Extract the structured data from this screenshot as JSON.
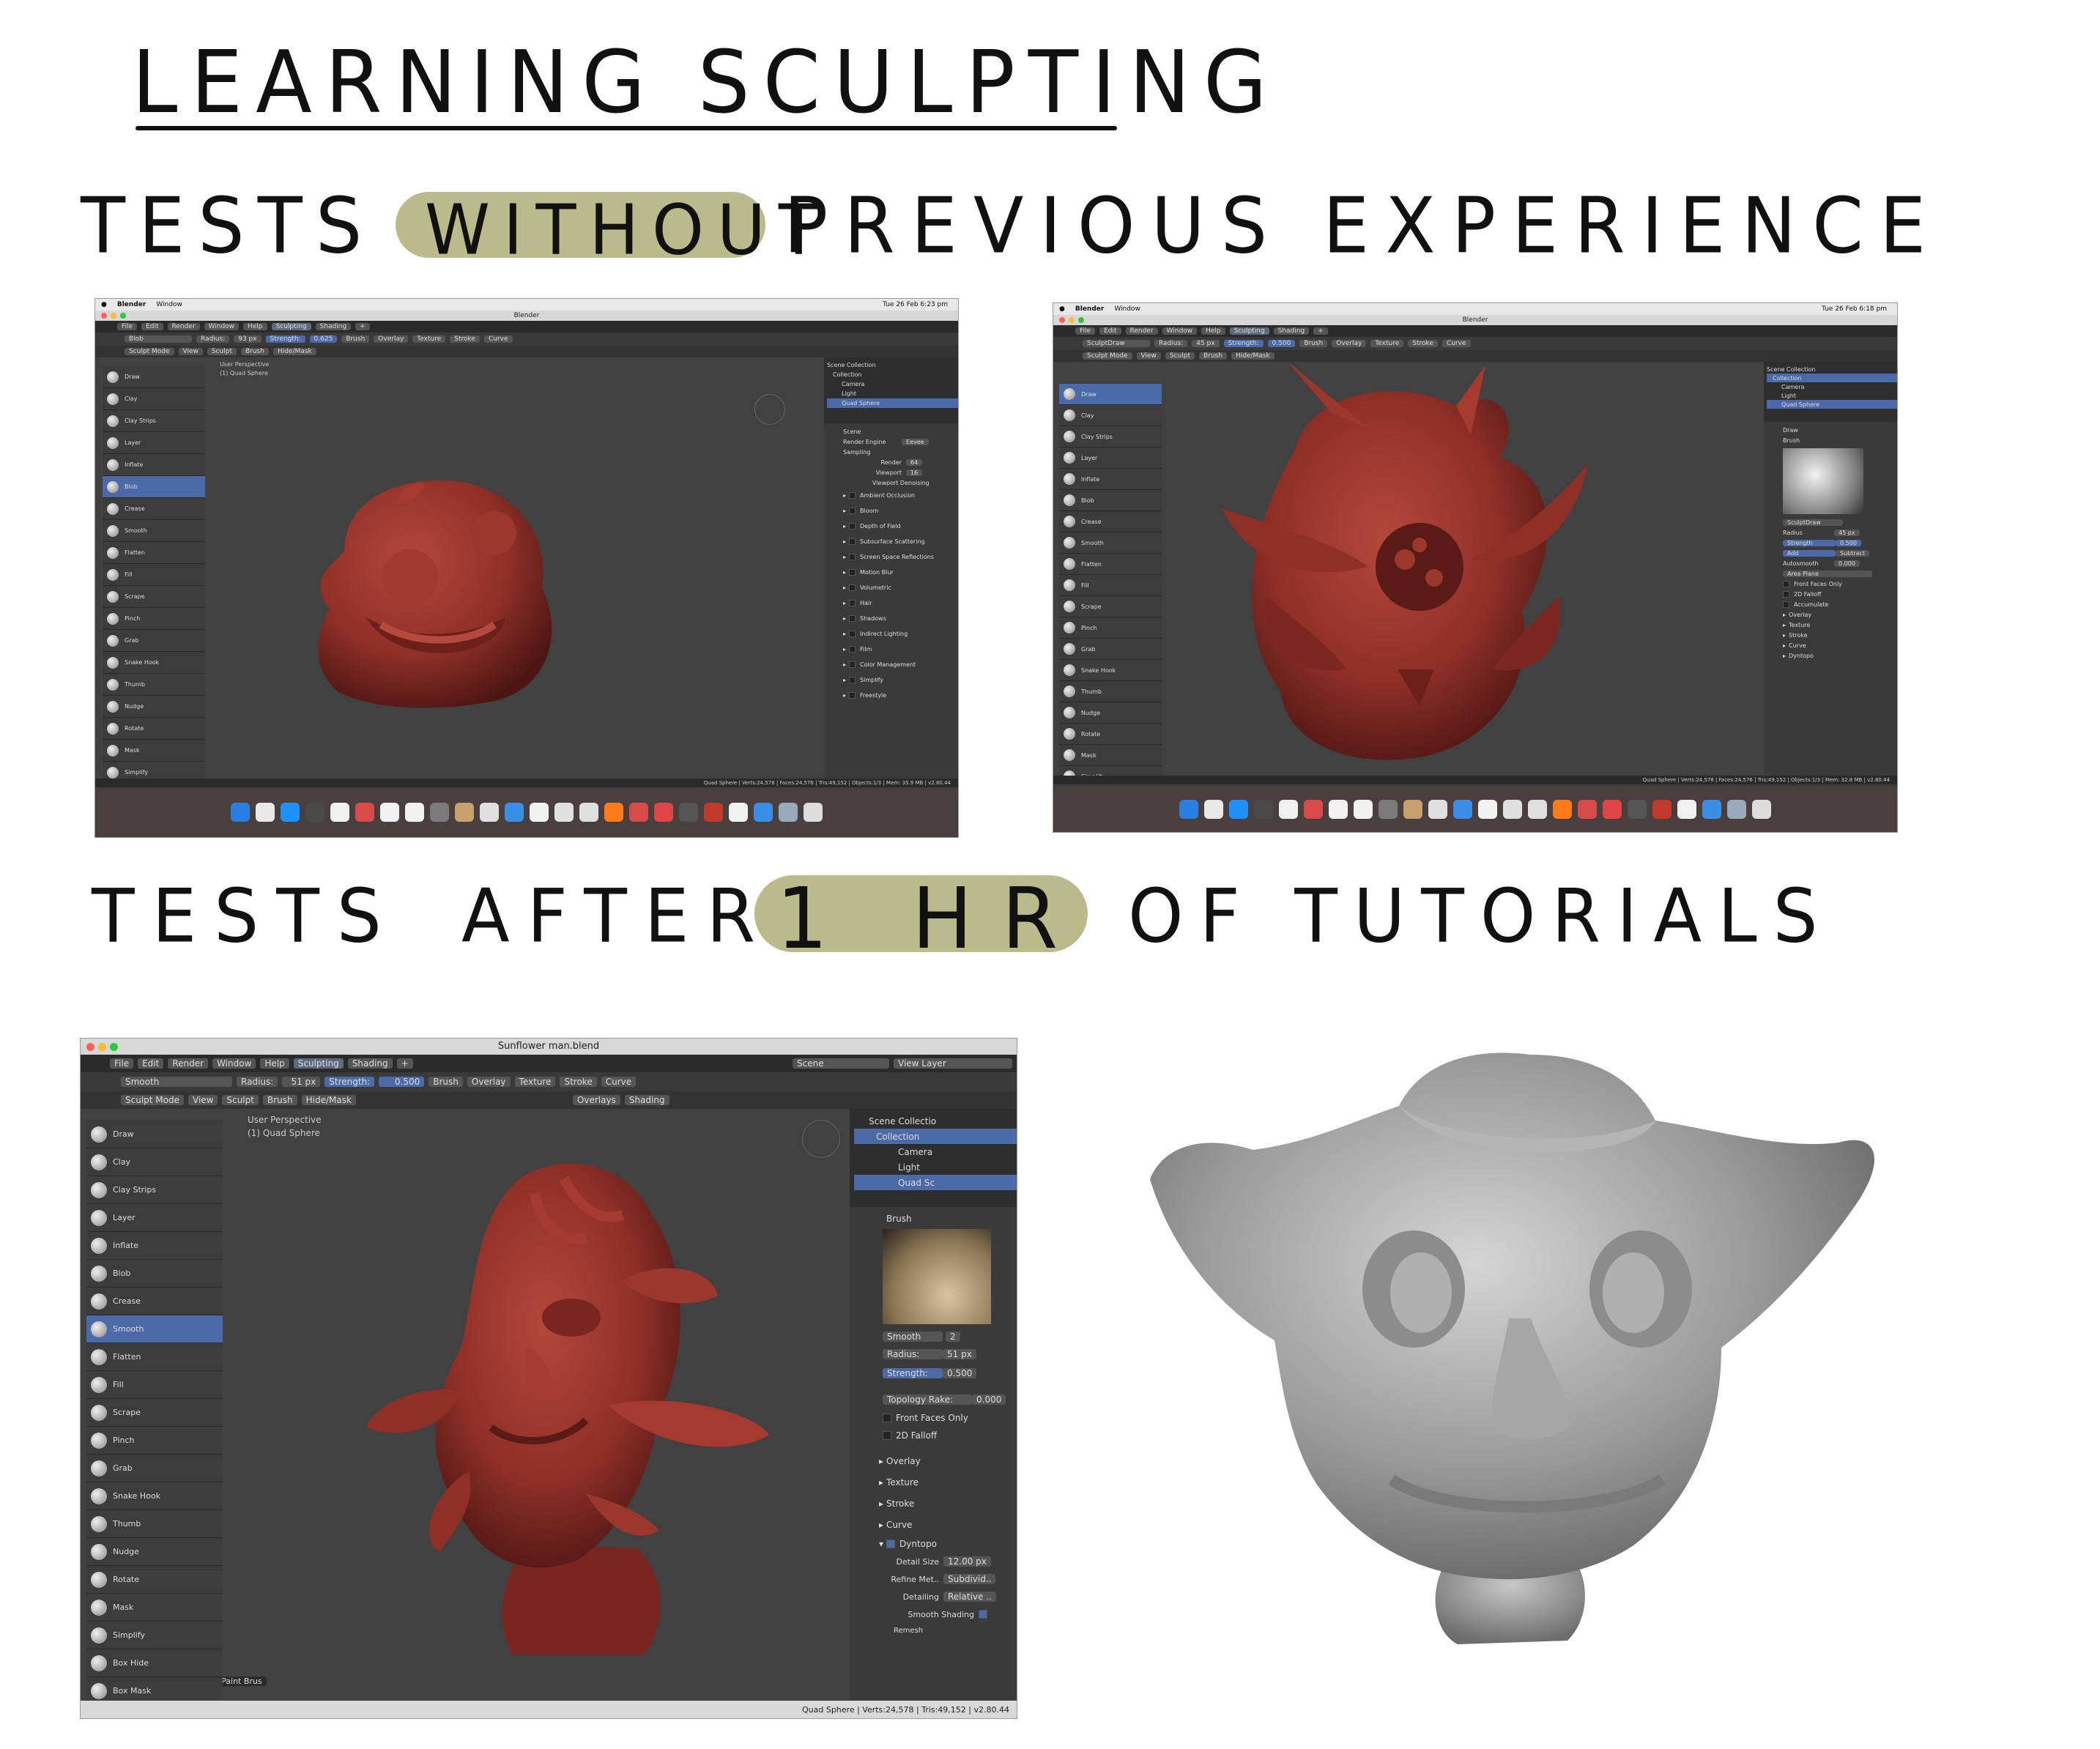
{
  "heading": "LEARNING SCULPTING",
  "row1": {
    "prefix": "TESTS",
    "highlight": "WITHOUT",
    "suffix": "PREVIOUS EXPERIENCE"
  },
  "row2": {
    "prefix": "TESTS",
    "middle": "AFTER",
    "highlight": "1 HR",
    "suffix": "OF TUTORIALS"
  },
  "colors": {
    "highlight": "#b9bb8c",
    "model_red": "#8e2f28",
    "model_gray": "#9a9a9a",
    "blender_bg": "#3d3d3d",
    "blender_select": "#4d6aa8"
  },
  "shot1": {
    "menubar": [
      "Blender",
      "Window"
    ],
    "menubar_right": "Tue 26 Feb 6:23 pm",
    "window_title": "Blender",
    "menus": [
      "File",
      "Edit",
      "Render",
      "Window",
      "Help",
      "Sculpting",
      "Shading",
      "+"
    ],
    "brush": "Blob",
    "radius_label": "Radius:",
    "radius_value": "93 px",
    "strength_label": "Strength:",
    "strength_value": "0.625",
    "header_dropdowns": [
      "Brush",
      "Overlay",
      "Texture",
      "Stroke",
      "Curve"
    ],
    "mode": "Sculpt Mode",
    "mode_tabs": [
      "View",
      "Sculpt",
      "Brush",
      "Hide/Mask"
    ],
    "vp_line1": "User Perspective",
    "vp_line2": "(1) Quad Sphere",
    "tools": [
      "Draw",
      "Clay",
      "Clay Strips",
      "Layer",
      "Inflate",
      "Blob",
      "Crease",
      "Smooth",
      "Flatten",
      "Fill",
      "Scrape",
      "Pinch",
      "Grab",
      "Snake Hook",
      "Thumb",
      "Nudge",
      "Rotate",
      "Mask",
      "Simplify"
    ],
    "active_tool": "Blob",
    "outliner": [
      "Scene Collection",
      "Collection",
      "Camera",
      "Light",
      "Quad Sphere"
    ],
    "props_title": "Scene",
    "render_engine_label": "Render Engine",
    "render_engine": "Eevee",
    "sampling": "Sampling",
    "render_label": "Render",
    "render_value": "64",
    "viewport_label": "Viewport",
    "viewport_value": "16",
    "denoise": "Viewport Denoising",
    "panels": [
      "Ambient Occlusion",
      "Bloom",
      "Depth of Field",
      "Subsurface Scattering",
      "Screen Space Reflections",
      "Motion Blur",
      "Volumetric",
      "Hair",
      "Shadows",
      "Indirect Lighting",
      "Film",
      "Color Management",
      "Simplify",
      "Freestyle"
    ],
    "status": "Quad Sphere | Verts:24,578 | Faces:24,576 | Tris:49,152 | Objects:1/3 | Mem: 35.9 MB | v2.80.44"
  },
  "shot2": {
    "menubar": [
      "Blender",
      "Window"
    ],
    "menubar_right": "Tue 26 Feb 6:18 pm",
    "window_title": "Blender",
    "menus": [
      "File",
      "Edit",
      "Render",
      "Window",
      "Help",
      "Sculpting",
      "Shading",
      "+"
    ],
    "brush": "SculptDraw",
    "radius_label": "Radius:",
    "radius_value": "45 px",
    "strength_label": "Strength:",
    "strength_value": "0.500",
    "header_dropdowns": [
      "Brush",
      "Overlay",
      "Texture",
      "Stroke",
      "Curve"
    ],
    "mode": "Sculpt Mode",
    "mode_tabs": [
      "View",
      "Sculpt",
      "Brush",
      "Hide/Mask"
    ],
    "tools": [
      "Draw",
      "Clay",
      "Clay Strips",
      "Layer",
      "Inflate",
      "Blob",
      "Crease",
      "Smooth",
      "Flatten",
      "Fill",
      "Scrape",
      "Pinch",
      "Grab",
      "Snake Hook",
      "Thumb",
      "Nudge",
      "Rotate",
      "Mask",
      "Simplify"
    ],
    "active_tool": "Draw",
    "outliner": [
      "Scene Collection",
      "Collection",
      "Camera",
      "Light",
      "Quad Sphere"
    ],
    "props_title": "Draw",
    "brush_section": "Brush",
    "brush_name": "SculptDraw",
    "p_radius_label": "Radius",
    "p_radius_value": "45 px",
    "p_strength_label": "Strength",
    "p_strength_value": "0.500",
    "add": "Add",
    "subtract": "Subtract",
    "autosmooth_label": "Autosmooth",
    "autosmooth_value": "0.000",
    "area_plane": "Area Plane",
    "checks": [
      "Front Faces Only",
      "2D Falloff",
      "Accumulate"
    ],
    "panels": [
      "Overlay",
      "Texture",
      "Stroke",
      "Curve",
      "Dyntopo"
    ],
    "status": "Quad Sphere | Verts:24,578 | Faces:24,576 | Tris:49,152 | Objects:1/3 | Mem: 32.8 MB | v2.80.44"
  },
  "shot3": {
    "window_title": "Sunflower man.blend",
    "menus": [
      "File",
      "Edit",
      "Render",
      "Window",
      "Help",
      "Sculpting",
      "Shading",
      "+"
    ],
    "scene": "Scene",
    "view_layer": "View Layer",
    "brush": "Smooth",
    "radius_label": "Radius:",
    "radius_value": "51 px",
    "strength_label": "Strength:",
    "strength_value": "0.500",
    "header_dropdowns": [
      "Brush",
      "Overlay",
      "Texture",
      "Stroke",
      "Curve"
    ],
    "mode": "Sculpt Mode",
    "mode_tabs": [
      "View",
      "Sculpt",
      "Brush",
      "Hide/Mask"
    ],
    "overlays": "Overlays",
    "shading": "Shading",
    "vp_line1": "User Perspective",
    "vp_line2": "(1) Quad Sphere",
    "tools": [
      "Draw",
      "Clay",
      "Clay Strips",
      "Layer",
      "Inflate",
      "Blob",
      "Crease",
      "Smooth",
      "Flatten",
      "Fill",
      "Scrape",
      "Pinch",
      "Grab",
      "Snake Hook",
      "Thumb",
      "Nudge",
      "Rotate",
      "Mask",
      "Simplify",
      "Box Hide",
      "Box Mask"
    ],
    "active_tool": "Smooth",
    "outliner": [
      "Scene Collectio",
      "Collection",
      "Camera",
      "Light",
      "Quad Sc"
    ],
    "brush_section": "Brush",
    "brush_name": "Smooth",
    "brush_users": "2",
    "p_radius_label": "Radius:",
    "p_radius_value": "51 px",
    "p_strength_label": "Strength:",
    "p_strength_value": "0.500",
    "topology_label": "Topology Rake:",
    "topology_value": "0.000",
    "checks": [
      "Front Faces Only",
      "2D Falloff"
    ],
    "panels": [
      "Overlay",
      "Texture",
      "Stroke",
      "Curve"
    ],
    "dyntopo": "Dyntopo",
    "detail_size_label": "Detail Size",
    "detail_size_value": "12.00 px",
    "refine_label": "Refine Met..",
    "refine_value": "Subdivid..",
    "detailing_label": "Detailing",
    "detailing_value": "Relative ..",
    "smooth_shading": "Smooth Shading",
    "remesh": "Remesh",
    "operator": "Scale Sculpt/Paint Brus",
    "status": "Quad Sphere | Verts:24,578 | Tris:49,152 | v2.80.44"
  }
}
